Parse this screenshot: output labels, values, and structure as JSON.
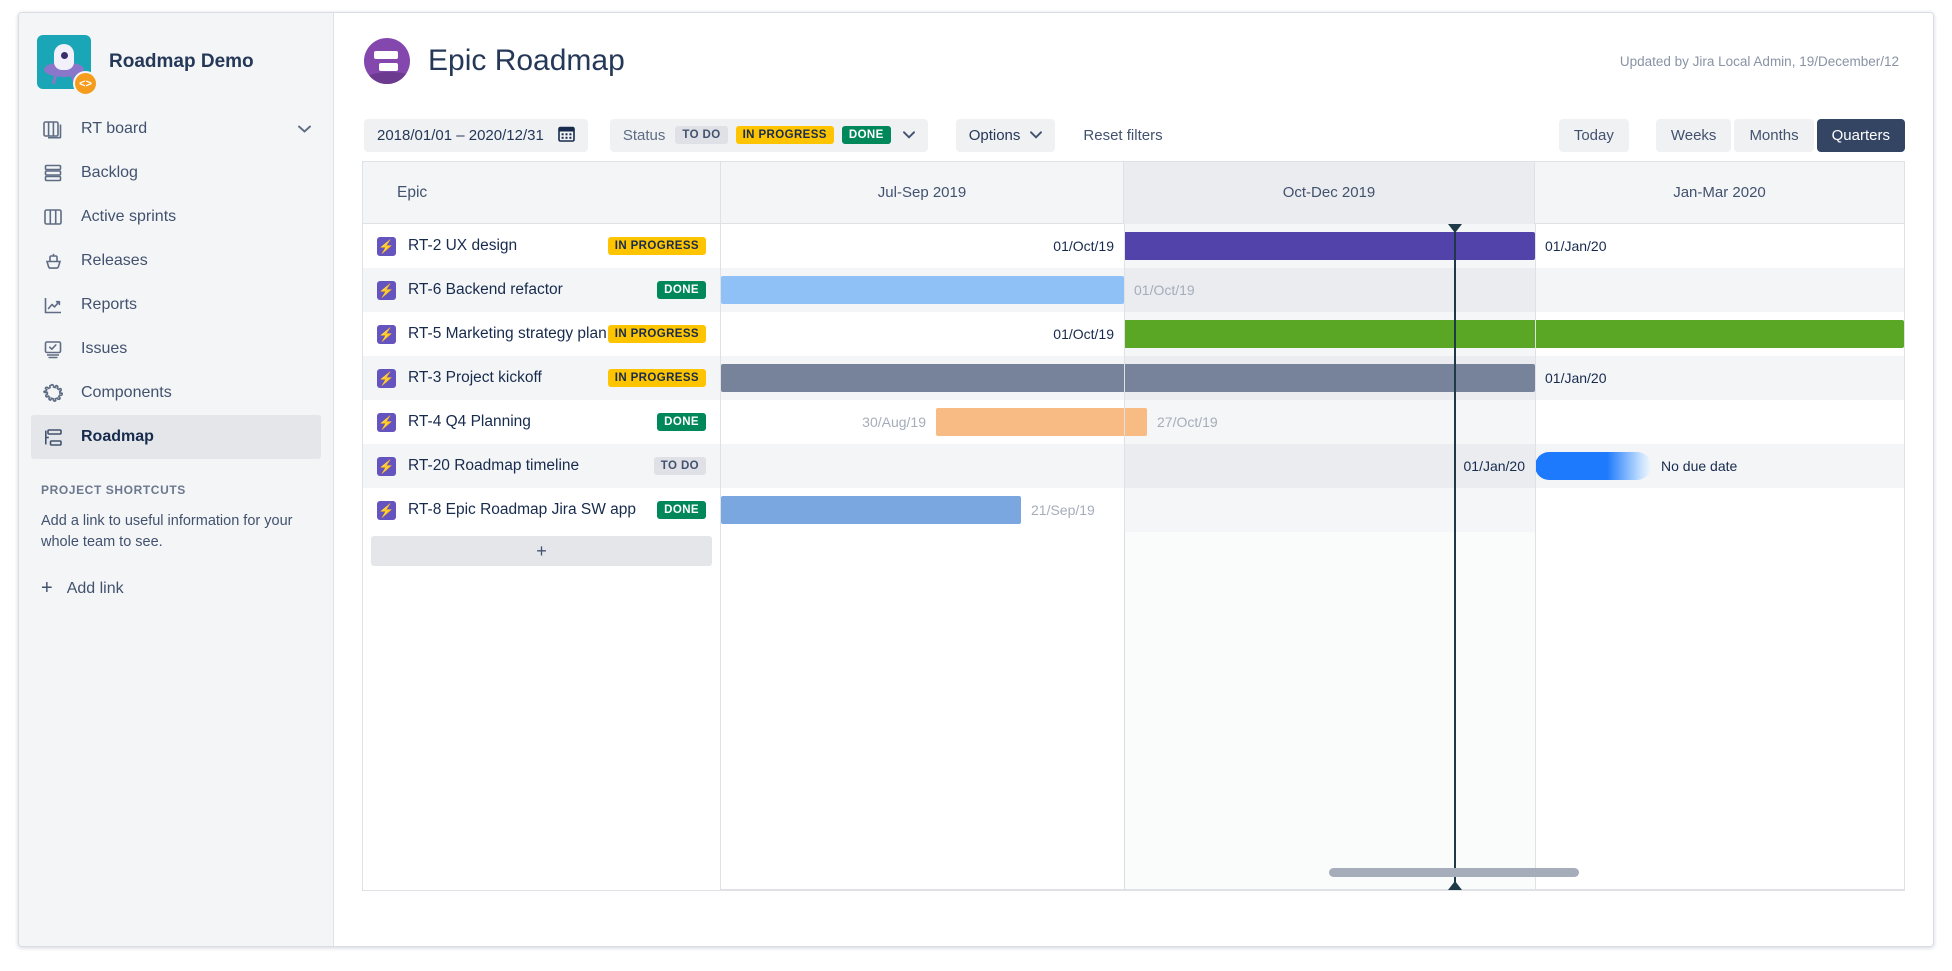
{
  "sidebar": {
    "project_name": "Roadmap Demo",
    "logo_badge": "<>",
    "board": {
      "label": "RT board",
      "icon": "board-icon",
      "chevron": "⌄"
    },
    "items": [
      {
        "label": "Backlog",
        "icon": "backlog-icon",
        "selected": false
      },
      {
        "label": "Active sprints",
        "icon": "columns-icon",
        "selected": false
      },
      {
        "label": "Releases",
        "icon": "ship-icon",
        "selected": false
      },
      {
        "label": "Reports",
        "icon": "chart-icon",
        "selected": false
      },
      {
        "label": "Issues",
        "icon": "issues-icon",
        "selected": false
      },
      {
        "label": "Components",
        "icon": "puzzle-icon",
        "selected": false
      },
      {
        "label": "Roadmap",
        "icon": "roadmap-icon",
        "selected": true
      }
    ],
    "shortcuts": {
      "title": "PROJECT SHORTCUTS",
      "description": "Add a link to useful information for your whole team to see.",
      "add_link": "Add link",
      "plus": "+"
    }
  },
  "header": {
    "title": "Epic Roadmap",
    "updated": "Updated by Jira Local Admin, 19/December/12"
  },
  "toolbar": {
    "date_range": "2018/01/01 – 2020/12/31",
    "calendar_icon": "📅",
    "status_label": "Status",
    "status_values": [
      "TO DO",
      "IN PROGRESS",
      "DONE"
    ],
    "chevron": "⌄",
    "options_label": "Options",
    "reset_filters": "Reset filters",
    "today_label": "Today",
    "scales": [
      {
        "label": "Weeks",
        "active": false
      },
      {
        "label": "Months",
        "active": false
      },
      {
        "label": "Quarters",
        "active": true
      }
    ]
  },
  "gantt": {
    "epic_column_header": "Epic",
    "add_row_label": "+",
    "quarters": [
      "Jul-Sep 2019",
      "Oct-Dec 2019",
      "Jan-Mar 2020"
    ],
    "epic_icon": "⚡",
    "rows": [
      {
        "key_summary": "RT-2 UX design",
        "status": "IN PROGRESS",
        "status_kind": "prog",
        "bar_color": "#5243aa",
        "start_label": "01/Oct/19",
        "end_label": "01/Jan/20",
        "start_label_muted": false,
        "end_label_muted": false
      },
      {
        "key_summary": "RT-6 Backend refactor",
        "status": "DONE",
        "status_kind": "done",
        "bar_color": "#8fc1f7",
        "start_label": "",
        "end_label": "01/Oct/19",
        "start_label_muted": true,
        "end_label_muted": true
      },
      {
        "key_summary": "RT-5 Marketing strategy plan",
        "status": "IN PROGRESS",
        "status_kind": "prog",
        "bar_color": "#5aa726",
        "start_label": "01/Oct/19",
        "end_label": "",
        "start_label_muted": false,
        "end_label_muted": false
      },
      {
        "key_summary": "RT-3 Project kickoff",
        "status": "IN PROGRESS",
        "status_kind": "prog",
        "bar_color": "#77839a",
        "start_label": "",
        "end_label": "01/Jan/20",
        "start_label_muted": false,
        "end_label_muted": false
      },
      {
        "key_summary": "RT-4 Q4 Planning",
        "status": "DONE",
        "status_kind": "done",
        "bar_color": "#f7bb83",
        "start_label": "30/Aug/19",
        "end_label": "27/Oct/19",
        "start_label_muted": true,
        "end_label_muted": true
      },
      {
        "key_summary": "RT-20 Roadmap timeline",
        "status": "TO DO",
        "status_kind": "todo",
        "bar_color": "#1d7afc",
        "start_label": "01/Jan/20",
        "end_label": "No due date",
        "start_label_muted": false,
        "end_label_muted": false
      },
      {
        "key_summary": "RT-8 Epic Roadmap Jira SW app",
        "status": "DONE",
        "status_kind": "done",
        "bar_color": "#7aa7e0",
        "start_label": "",
        "end_label": "21/Sep/19",
        "start_label_muted": true,
        "end_label_muted": true
      }
    ]
  },
  "chart_data": {
    "type": "bar",
    "title": "Epic Roadmap",
    "xlabel": "",
    "ylabel": "",
    "categories": [
      "RT-2 UX design",
      "RT-6 Backend refactor",
      "RT-5 Marketing strategy plan",
      "RT-3 Project kickoff",
      "RT-4 Q4 Planning",
      "RT-20 Roadmap timeline",
      "RT-8 Epic Roadmap Jira SW app"
    ],
    "axis_ticks": [
      "Jul-Sep 2019",
      "Oct-Dec 2019",
      "Jan-Mar 2020"
    ],
    "series": [
      {
        "name": "RT-2 UX design",
        "start": "2019-10-01",
        "end": "2020-01-01",
        "color": "#5243aa",
        "status": "IN PROGRESS"
      },
      {
        "name": "RT-6 Backend refactor",
        "start": "before-range",
        "end": "2019-10-01",
        "color": "#8fc1f7",
        "status": "DONE"
      },
      {
        "name": "RT-5 Marketing strategy plan",
        "start": "2019-10-01",
        "end": "after-range",
        "color": "#5aa726",
        "status": "IN PROGRESS"
      },
      {
        "name": "RT-3 Project kickoff",
        "start": "before-range",
        "end": "2020-01-01",
        "color": "#77839a",
        "status": "IN PROGRESS"
      },
      {
        "name": "RT-4 Q4 Planning",
        "start": "2019-08-30",
        "end": "2019-10-27",
        "color": "#f7bb83",
        "status": "DONE"
      },
      {
        "name": "RT-20 Roadmap timeline",
        "start": "2020-01-01",
        "end": "No due date",
        "color": "#1d7afc",
        "status": "TO DO"
      },
      {
        "name": "RT-8 Epic Roadmap Jira SW app",
        "start": "before-range",
        "end": "2019-09-21",
        "color": "#7aa7e0",
        "status": "DONE"
      }
    ],
    "today_marker": "2019-12-20",
    "grid": true,
    "legend": "none"
  }
}
